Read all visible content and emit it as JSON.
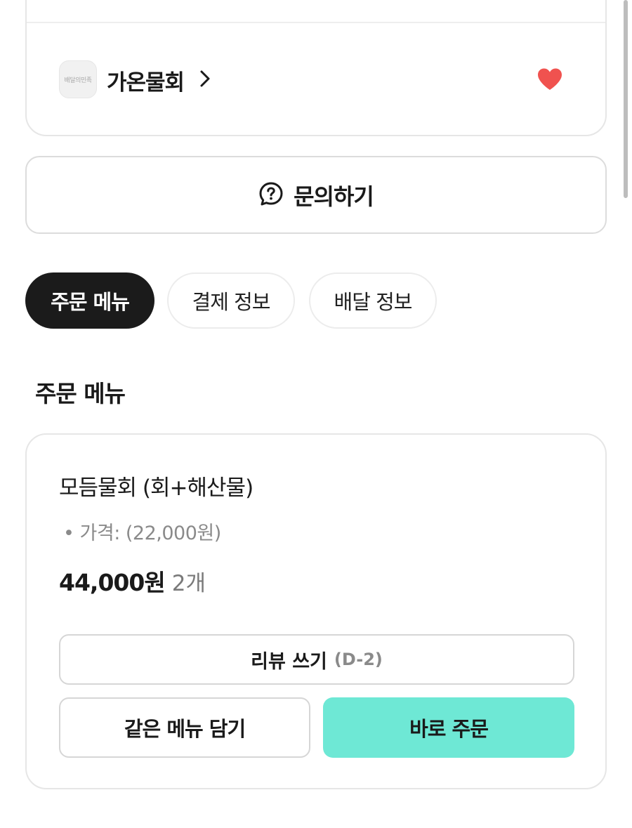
{
  "store": {
    "logo_text": "배달의민족",
    "name": "가온물회"
  },
  "inquiry": {
    "label": "문의하기"
  },
  "tabs": [
    {
      "label": "주문 메뉴",
      "active": true
    },
    {
      "label": "결제 정보",
      "active": false
    },
    {
      "label": "배달 정보",
      "active": false
    }
  ],
  "section_title": "주문 메뉴",
  "order_item": {
    "name": "모듬물회 (회+해산물)",
    "price_label": "• 가격:  (22,000원)",
    "total_amount": "44,000원",
    "quantity": "2개"
  },
  "actions": {
    "review_label": "리뷰 쓰기",
    "review_dday": "(D-2)",
    "add_same_label": "같은 메뉴 담기",
    "order_now_label": "바로 주문"
  },
  "colors": {
    "accent": "#6ee8d5",
    "heart": "#f0524f",
    "active_tab": "#1b1b1b"
  },
  "icons": {
    "favorite": "heart-icon",
    "store_link": "chevron-right-icon",
    "inquiry": "question-bubble-icon"
  }
}
